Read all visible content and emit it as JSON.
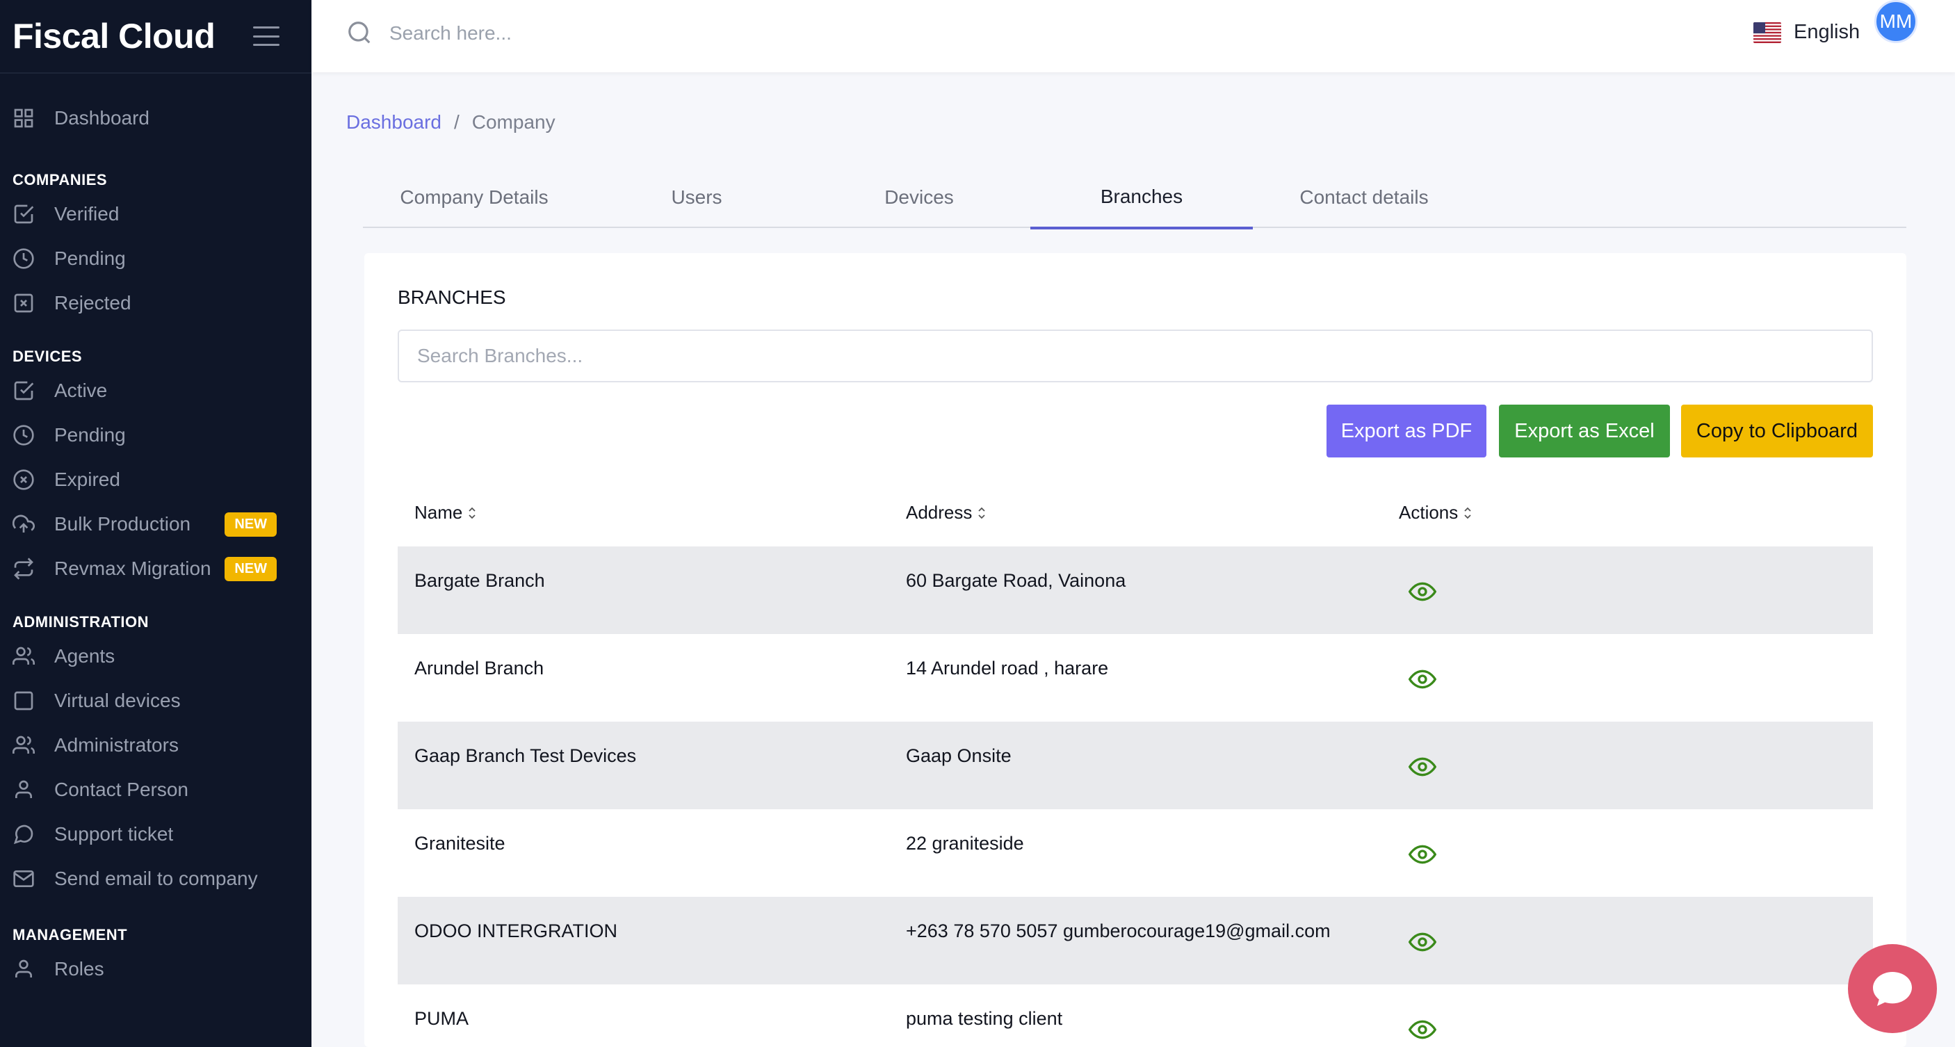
{
  "brand": "Fiscal Cloud",
  "search": {
    "placeholder": "Search here..."
  },
  "language": "English",
  "user_initials": "MM",
  "sidebar": {
    "dashboard": "Dashboard",
    "sections": {
      "companies": "COMPANIES",
      "devices": "DEVICES",
      "administration": "ADMINISTRATION",
      "management": "MANAGEMENT"
    },
    "companies": [
      "Verified",
      "Pending",
      "Rejected"
    ],
    "devices": [
      "Active",
      "Pending",
      "Expired",
      "Bulk Production",
      "Revmax Migration"
    ],
    "new_badge": "NEW",
    "administration": [
      "Agents",
      "Virtual devices",
      "Administrators",
      "Contact Person",
      "Support ticket",
      "Send email to company"
    ],
    "management": [
      "Roles"
    ]
  },
  "breadcrumb": {
    "home": "Dashboard",
    "separator": "/",
    "current": "Company"
  },
  "tabs": [
    "Company Details",
    "Users",
    "Devices",
    "Branches",
    "Contact details"
  ],
  "active_tab": "Branches",
  "card": {
    "title": "BRANCHES",
    "search_placeholder": "Search Branches...",
    "buttons": {
      "pdf": "Export as PDF",
      "excel": "Export as Excel",
      "copy": "Copy to Clipboard"
    },
    "columns": [
      "Name",
      "Address",
      "Actions"
    ],
    "rows": [
      {
        "name": "Bargate Branch",
        "address": "60 Bargate Road, Vainona"
      },
      {
        "name": "Arundel Branch",
        "address": "14 Arundel road , harare"
      },
      {
        "name": "Gaap Branch Test Devices",
        "address": "Gaap Onsite"
      },
      {
        "name": "Granitesite",
        "address": "22 graniteside"
      },
      {
        "name": "ODOO INTERGRATION",
        "address": "+263 78 570 5057 gumberocourage19@gmail.com"
      },
      {
        "name": "PUMA",
        "address": "puma testing client"
      }
    ]
  },
  "colors": {
    "sidebar": "#0f1628",
    "accent": "#5b5fd1",
    "pdf": "#7468f3",
    "excel": "#3c9c3c",
    "copy": "#f2bb00",
    "chat": "#e0566e",
    "eye": "#3a8a1a"
  }
}
